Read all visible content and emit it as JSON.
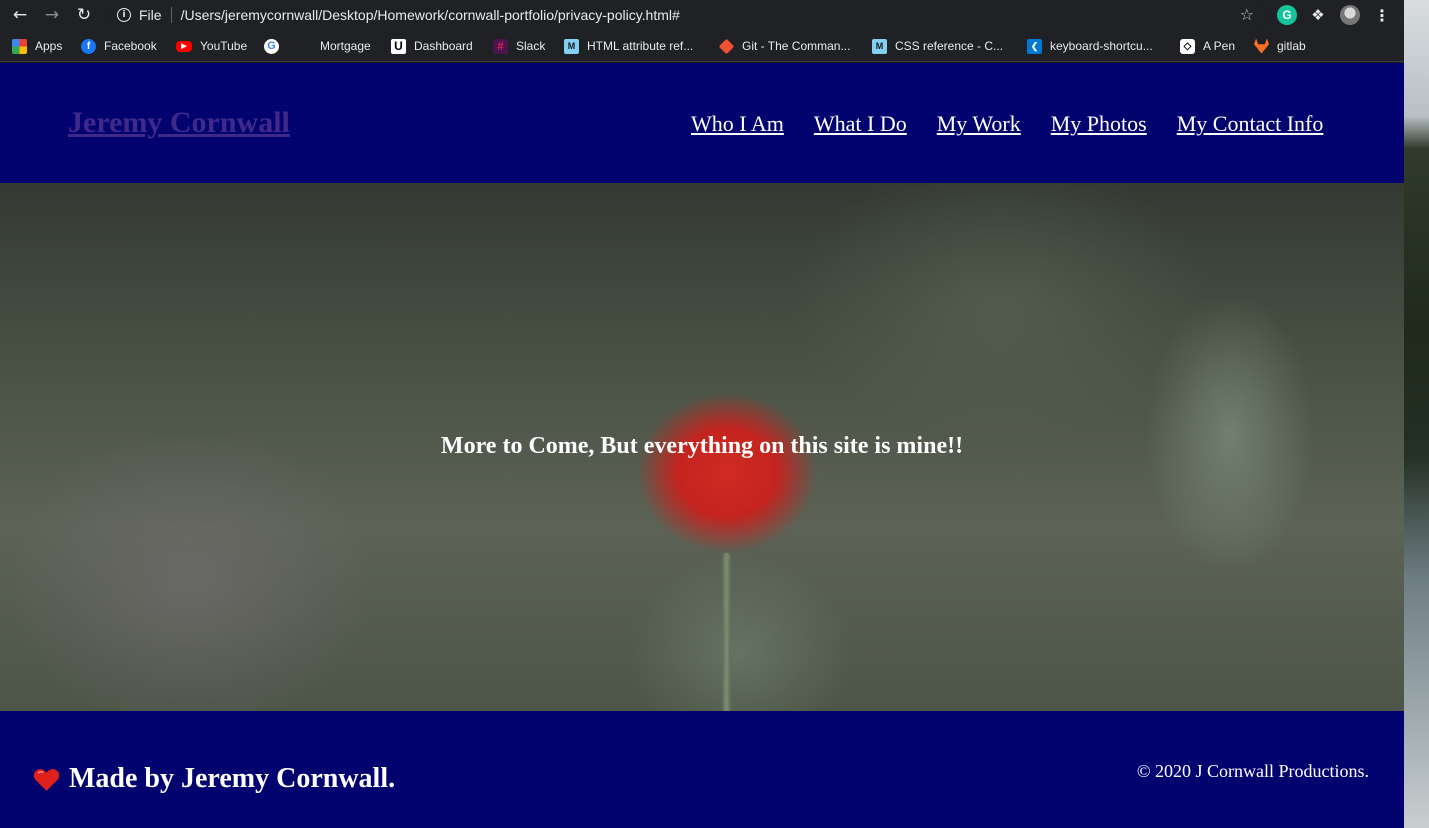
{
  "browser": {
    "scheme_label": "File",
    "url": "/Users/jeremycornwall/Desktop/Homework/cornwall-portfolio/privacy-policy.html#",
    "extension_grammarly_letter": "G",
    "bookmarks": [
      {
        "label": "Apps",
        "icon": "apps-grid-icon"
      },
      {
        "label": "Facebook",
        "icon": "facebook-icon"
      },
      {
        "label": "YouTube",
        "icon": "youtube-icon"
      },
      {
        "label": "",
        "icon": "google-icon"
      },
      {
        "label": "Mortgage",
        "icon": ""
      },
      {
        "label": "Dashboard",
        "icon": "u-logo-icon"
      },
      {
        "label": "Slack",
        "icon": "slack-icon"
      },
      {
        "label": "HTML attribute ref...",
        "icon": "mdn-icon"
      },
      {
        "label": "Git - The Comman...",
        "icon": "git-icon"
      },
      {
        "label": "CSS reference - C...",
        "icon": "mdn-icon"
      },
      {
        "label": "keyboard-shortcu...",
        "icon": "vscode-icon"
      },
      {
        "label": "A Pen",
        "icon": "codepen-icon"
      },
      {
        "label": "gitlab",
        "icon": "gitlab-icon"
      }
    ]
  },
  "site": {
    "brand": "Jeremy Cornwall",
    "nav": [
      "Who I Am",
      "What I Do",
      "My Work",
      "My Photos",
      "My Contact Info"
    ],
    "hero_text": "More to Come, But everything on this site is mine!!",
    "footer_made_by": "Made by Jeremy Cornwall.",
    "footer_copyright": "© 2020 J Cornwall Productions."
  },
  "colors": {
    "header_bg": "#030370",
    "footer_bg": "#030370",
    "brand_link": "#3f2a8c",
    "nav_link": "#ffffff",
    "heart": "#e0201b"
  }
}
